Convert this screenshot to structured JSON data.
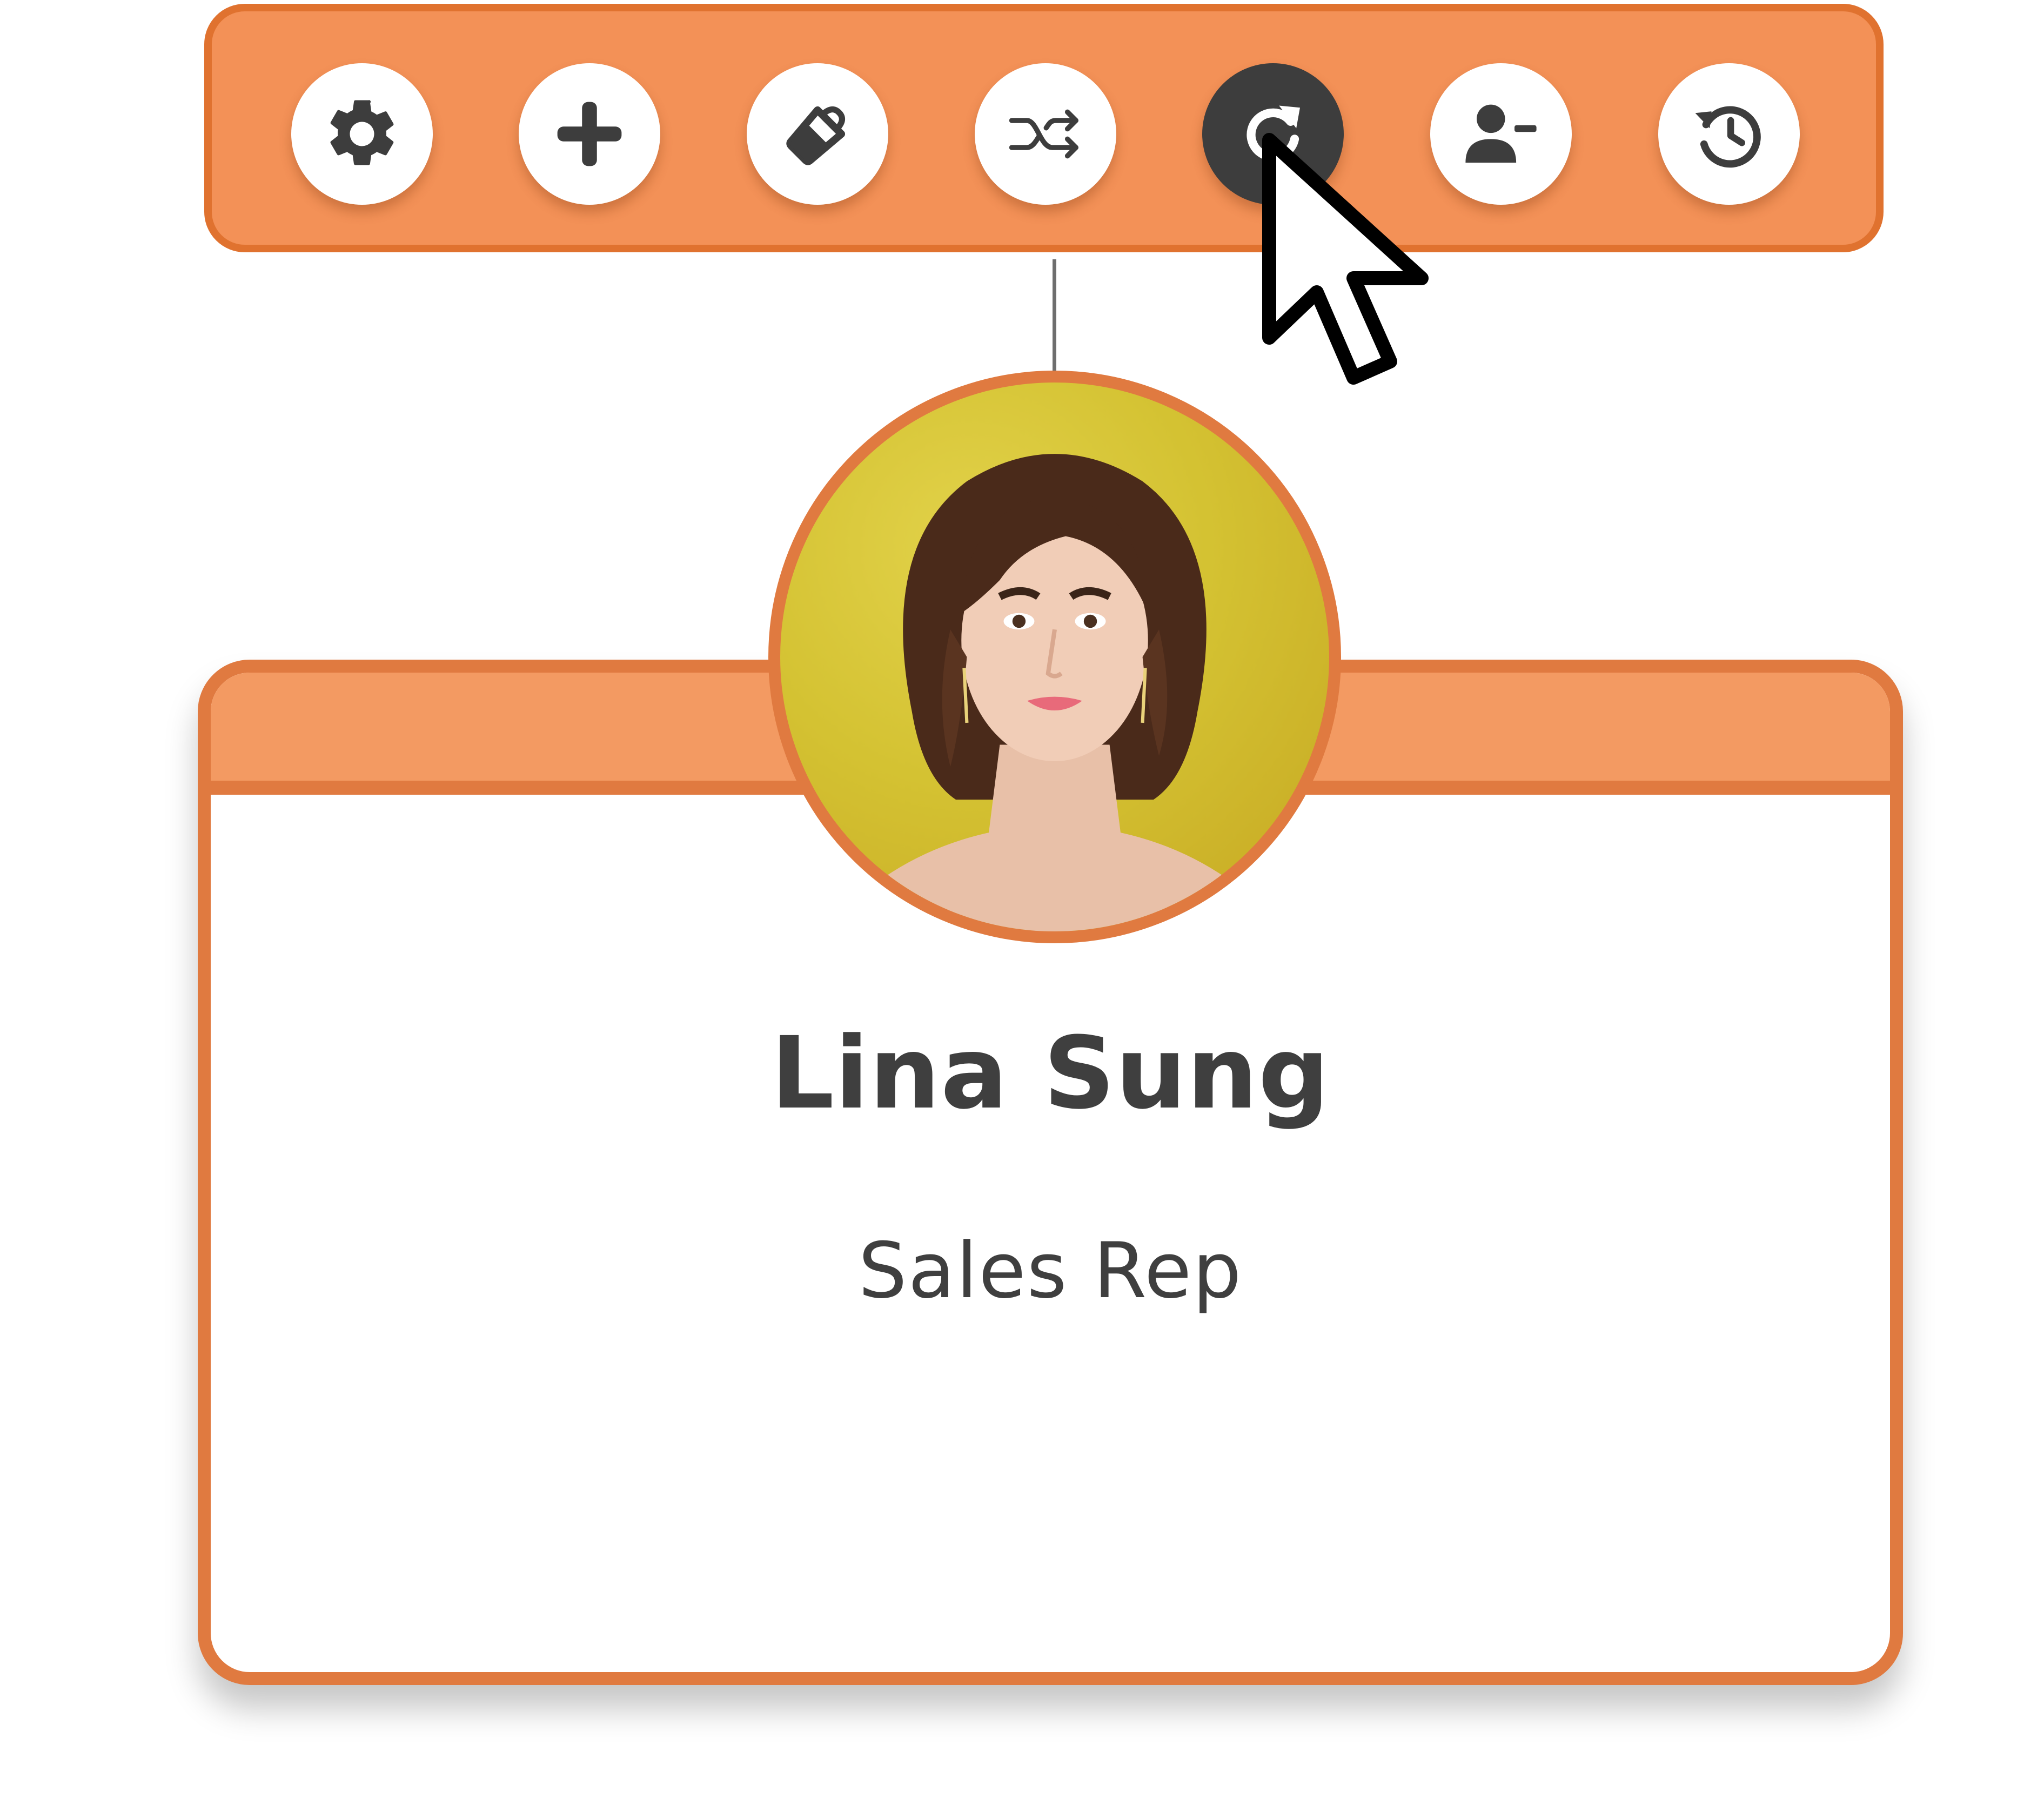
{
  "toolbar": {
    "buttons": [
      {
        "icon": "gear-icon",
        "active": false
      },
      {
        "icon": "plus-icon",
        "active": false
      },
      {
        "icon": "paint-bucket-icon",
        "active": false
      },
      {
        "icon": "shuffle-icon",
        "active": false
      },
      {
        "icon": "refresh-icon",
        "active": true
      },
      {
        "icon": "remove-user-icon",
        "active": false
      },
      {
        "icon": "history-icon",
        "active": false
      }
    ]
  },
  "card": {
    "name": "Lina Sung",
    "role": "Sales Rep"
  },
  "colors": {
    "toolbar_fill": "#f39157",
    "toolbar_border": "#e0722f",
    "card_border": "#e07a40",
    "card_band": "#f39a62",
    "text": "#3f3f3f",
    "icon": "#3d3d3d",
    "avatar_background": "#d4c232"
  }
}
